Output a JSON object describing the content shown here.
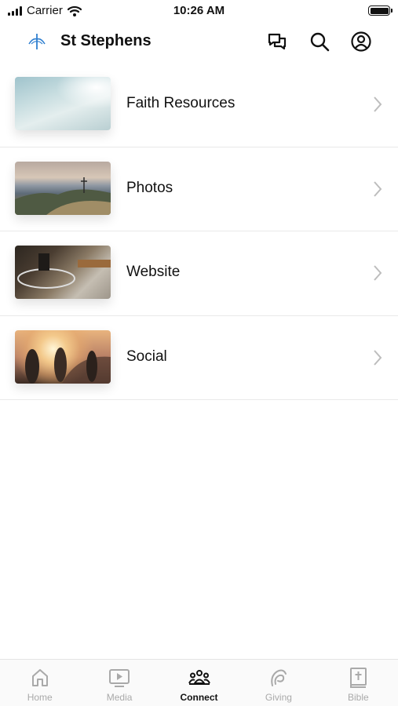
{
  "status_bar": {
    "carrier": "Carrier",
    "time": "10:26 AM"
  },
  "header": {
    "title": "St Stephens",
    "logo_color": "#2f7fd0"
  },
  "icons": {
    "messages": "chat-bubbles-icon",
    "search": "search-icon",
    "profile": "profile-icon"
  },
  "list": {
    "items": [
      {
        "label": "Faith Resources",
        "image": "ocean-waves-photo"
      },
      {
        "label": "Photos",
        "image": "mountain-cross-photo"
      },
      {
        "label": "Website",
        "image": "glass-table-interior-photo"
      },
      {
        "label": "Social",
        "image": "people-sunset-photo"
      }
    ]
  },
  "tabs": [
    {
      "label": "Home",
      "icon": "home-icon",
      "active": false
    },
    {
      "label": "Media",
      "icon": "play-icon",
      "active": false
    },
    {
      "label": "Connect",
      "icon": "people-icon",
      "active": true
    },
    {
      "label": "Giving",
      "icon": "giving-icon",
      "active": false
    },
    {
      "label": "Bible",
      "icon": "bible-icon",
      "active": false
    }
  ],
  "colors": {
    "active_tab": "#111111",
    "inactive_tab": "#a9a9a9",
    "divider": "#e9e9e9"
  }
}
